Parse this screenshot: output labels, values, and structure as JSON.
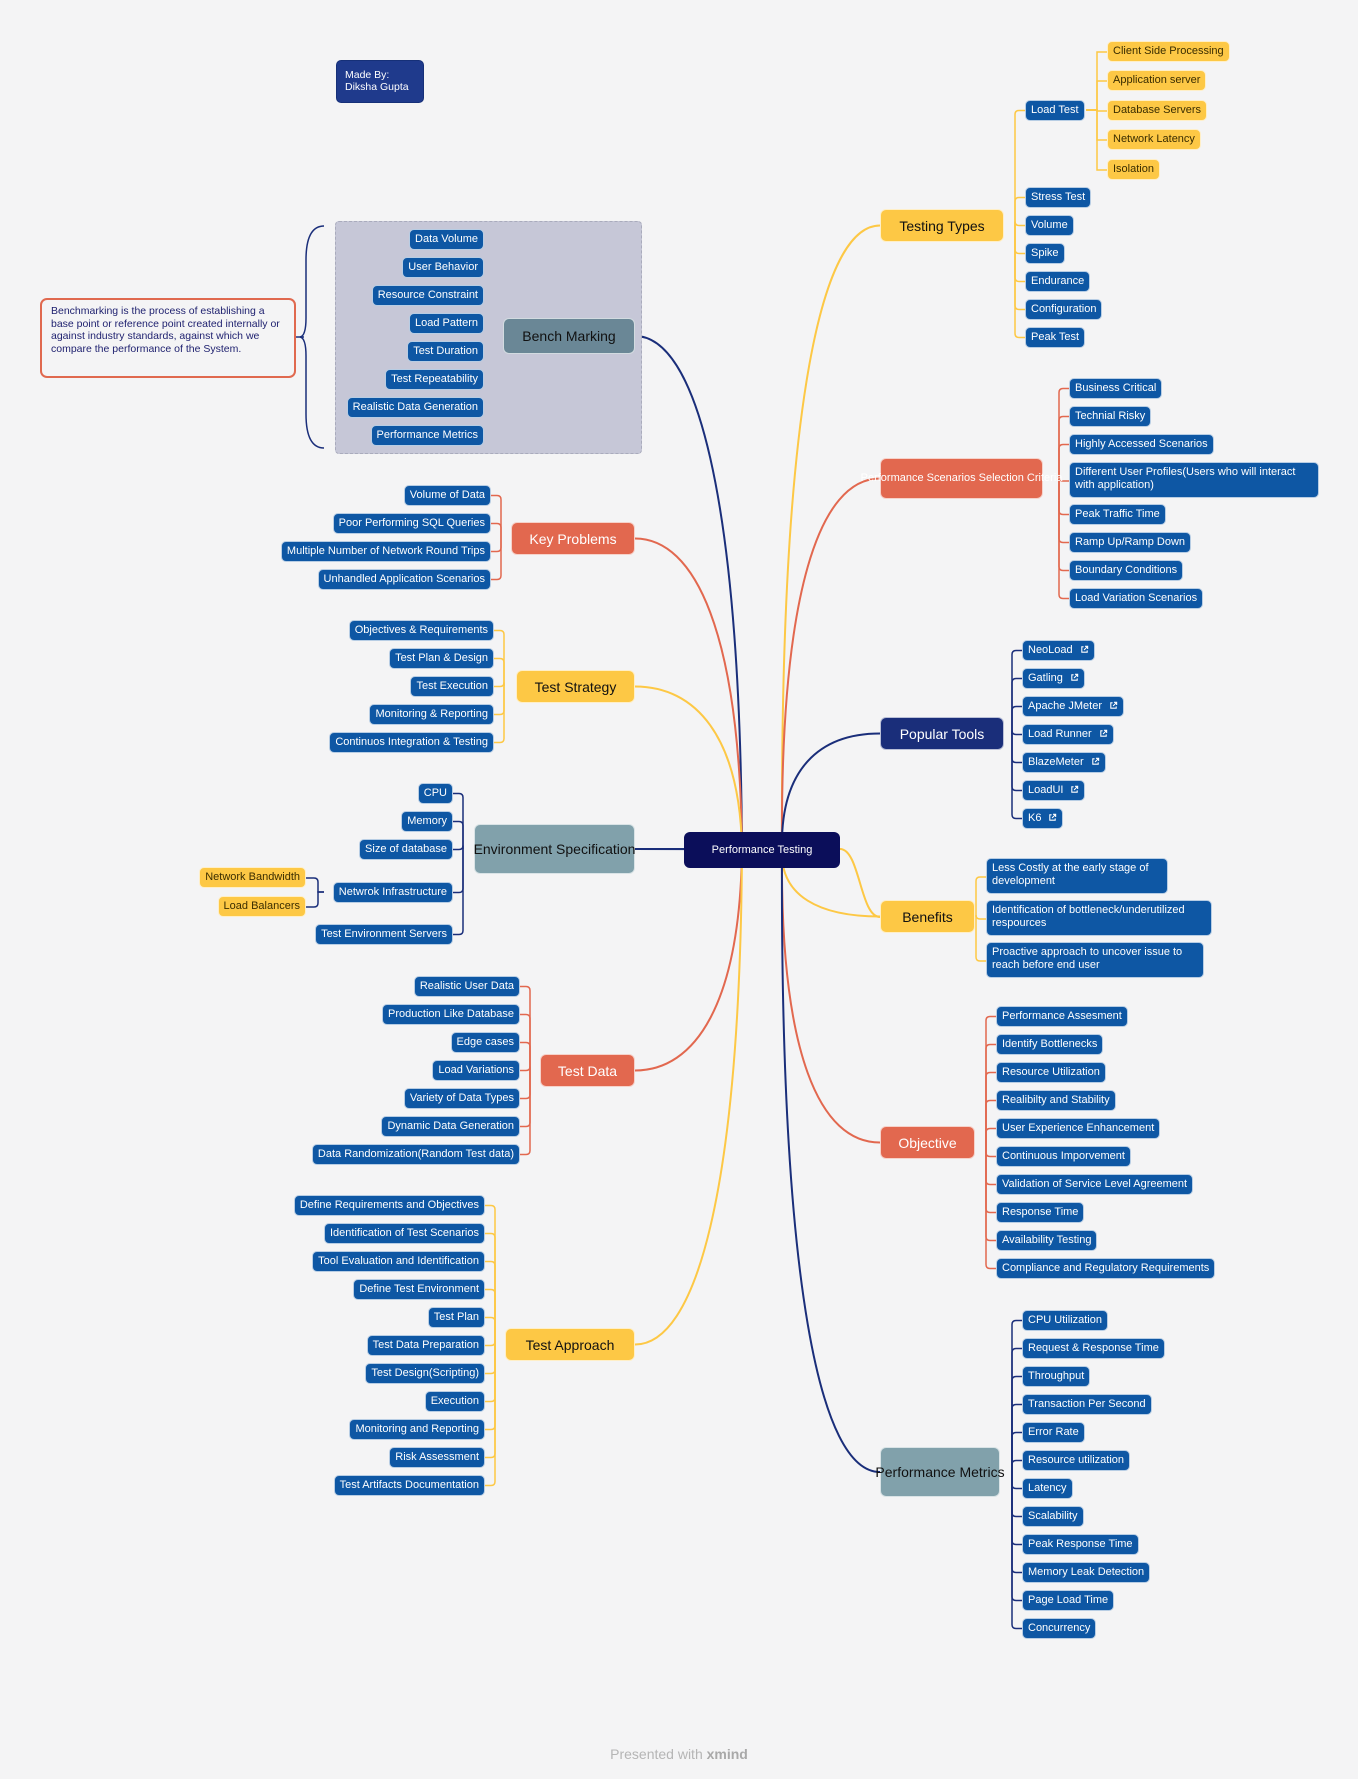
{
  "credit": {
    "line1": "Made By:",
    "line2": "Diksha Gupta"
  },
  "note": {
    "text": "Benchmarking is the process of establishing a base point or reference point created internally or against industry standards, against which we compare the performance of the System."
  },
  "central": {
    "label": "Performance Testing"
  },
  "colors": {
    "navy": "#1a2e7a",
    "red": "#e2684f",
    "yellow": "#fdc845",
    "leaf": "#0e57a4",
    "center": "#0b0e5a"
  },
  "left": {
    "bench_marking": {
      "label": "Bench Marking",
      "items": [
        "Data Volume",
        "User Behavior",
        "Resource Constraint",
        "Load Pattern",
        "Test Duration",
        "Test Repeatability",
        "Realistic Data Generation",
        "Performance Metrics"
      ]
    },
    "key_problems": {
      "label": "Key Problems",
      "items": [
        "Volume of Data",
        "Poor Performing SQL Queries",
        "Multiple Number of Network Round Trips",
        "Unhandled Application Scenarios"
      ]
    },
    "test_strategy": {
      "label": "Test Strategy",
      "items": [
        "Objectives & Requirements",
        "Test Plan & Design",
        "Test Execution",
        "Monitoring & Reporting",
        "Continuos Integration & Testing"
      ]
    },
    "environment": {
      "label": "Environment Specification",
      "items": [
        "CPU",
        "Memory",
        "Size of database",
        "Netwrok Infrastructure",
        "Test Environment Servers"
      ],
      "network_sub": [
        "Network Bandwidth",
        "Load Balancers"
      ]
    },
    "test_data": {
      "label": "Test Data",
      "items": [
        "Realistic User Data",
        "Production Like Database",
        "Edge cases",
        "Load Variations",
        "Variety of Data Types",
        "Dynamic Data Generation",
        "Data Randomization(Random Test data)"
      ]
    },
    "test_approach": {
      "label": "Test Approach",
      "items": [
        "Define Requirements and Objectives",
        "Identification of Test Scenarios",
        "Tool Evaluation and Identification",
        "Define Test Environment",
        "Test Plan",
        "Test Data Preparation",
        "Test Design(Scripting)",
        "Execution",
        "Monitoring and Reporting",
        "Risk Assessment",
        "Test Artifacts Documentation"
      ]
    }
  },
  "right": {
    "testing_types": {
      "label": "Testing Types",
      "items": [
        "Load Test",
        "Stress Test",
        "Volume",
        "Spike",
        "Endurance",
        "Configuration",
        "Peak Test"
      ],
      "load_test_sub": [
        "Client Side Processing",
        "Application server",
        "Database Servers",
        "Network Latency",
        "Isolation"
      ]
    },
    "scenarios": {
      "label": "Performance Scenarios Selection Criteria",
      "items": [
        "Business Critical",
        "Technial Risky",
        "Highly Accessed Scenarios",
        "Different User Profiles(Users who will interact with application)",
        "Peak Traffic Time",
        "Ramp Up/Ramp Down",
        "Boundary Conditions",
        "Load Variation Scenarios"
      ]
    },
    "tools": {
      "label": "Popular Tools",
      "items": [
        "NeoLoad",
        "Gatling",
        "Apache JMeter",
        "Load Runner",
        "BlazeMeter",
        "LoadUI",
        "K6"
      ],
      "item_icon": "external-link-icon"
    },
    "benefits": {
      "label": "Benefits",
      "items": [
        "Less Costly at the early stage of development",
        "Identification of bottleneck/underutilized respources",
        "Proactive approach to uncover issue to reach before end user"
      ]
    },
    "objective": {
      "label": "Objective",
      "items": [
        "Performance Assesment",
        "Identify Bottlenecks",
        "Resource Utilization",
        "Realibilty and Stability",
        "User Experience Enhancement",
        "Continuous Imporvement",
        "Validation of Service Level Agreement",
        "Response Time",
        "Availability Testing",
        "Compliance and Regulatory Requirements"
      ]
    },
    "metrics": {
      "label": "Performance Metrics",
      "items": [
        "CPU Utilization",
        "Request & Response Time",
        "Throughput",
        "Transaction Per Second",
        "Error Rate",
        "Resource utilization",
        "Latency",
        "Scalability",
        "Peak Response Time",
        "Memory Leak Detection",
        "Page Load Time",
        "Concurrency"
      ]
    }
  },
  "footer": {
    "prefix": "Presented with",
    "brand": "xmind"
  }
}
